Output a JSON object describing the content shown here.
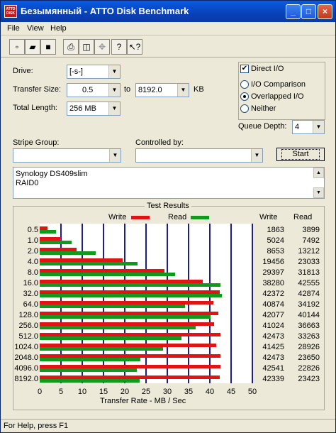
{
  "window": {
    "title": "Безымянный - ATTO Disk Benchmark",
    "icon_text": "ATTO DISK"
  },
  "menu": [
    "File",
    "View",
    "Help"
  ],
  "toolbar": [
    "new-file-icon",
    "open-folder-icon",
    "save-icon",
    "print-icon",
    "print-preview-icon",
    "move-icon",
    "help-icon",
    "context-help-icon"
  ],
  "form": {
    "drive_label": "Drive:",
    "drive_value": "[-s-]",
    "transfer_size_label": "Transfer Size:",
    "transfer_from": "0.5",
    "transfer_to_label": "to",
    "transfer_to": "8192.0",
    "transfer_unit": "KB",
    "total_length_label": "Total Length:",
    "total_length_value": "256 MB",
    "direct_io_label": "Direct I/O",
    "io_comparison_label": "I/O Comparison",
    "overlapped_io_label": "Overlapped I/O",
    "neither_label": "Neither",
    "queue_depth_label": "Queue Depth:",
    "queue_depth_value": "4",
    "stripe_group_label": "Stripe Group:",
    "controlled_by_label": "Controlled by:",
    "start_label": "Start",
    "description": [
      "Synology DS409slim",
      "RAID0"
    ]
  },
  "results": {
    "title": "Test Results",
    "legend_write": "Write",
    "legend_read": "Read",
    "col_write": "Write",
    "col_read": "Read",
    "xlabel": "Transfer Rate - MB / Sec"
  },
  "chart_data": {
    "type": "bar",
    "title": "Test Results",
    "xlabel": "Transfer Rate - MB / Sec",
    "categories": [
      "0.5",
      "1.0",
      "2.0",
      "4.0",
      "8.0",
      "16.0",
      "32.0",
      "64.0",
      "128.0",
      "256.0",
      "512.0",
      "1024.0",
      "2048.0",
      "4096.0",
      "8192.0"
    ],
    "xlim": [
      0,
      50
    ],
    "xticks": [
      "0",
      "5",
      "10",
      "15",
      "20",
      "25",
      "30",
      "35",
      "40",
      "45",
      "50"
    ],
    "series": [
      {
        "name": "Write",
        "color": "#e01414",
        "values": [
          1863,
          5024,
          8653,
          19456,
          29397,
          38280,
          42372,
          40874,
          42077,
          41024,
          42473,
          41425,
          42473,
          42541,
          42339
        ]
      },
      {
        "name": "Read",
        "color": "#11991e",
        "values": [
          3899,
          7492,
          13212,
          23033,
          31813,
          42555,
          42874,
          34192,
          40144,
          36663,
          33263,
          28926,
          23650,
          22826,
          23423
        ]
      }
    ],
    "grid": true
  },
  "status": "For Help, press F1"
}
